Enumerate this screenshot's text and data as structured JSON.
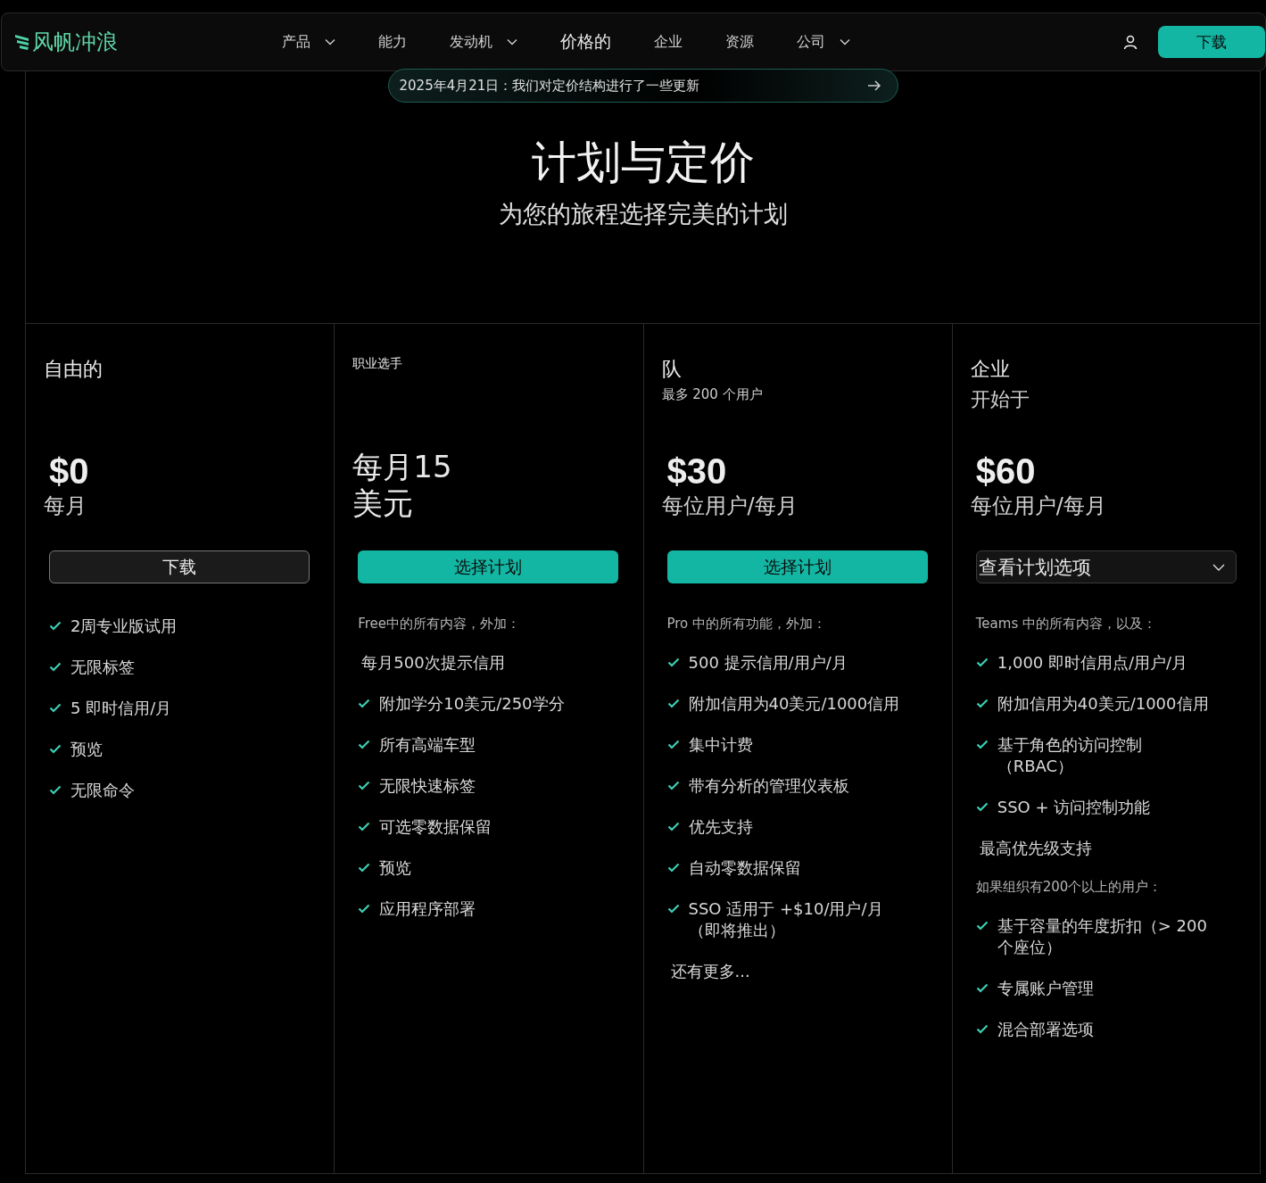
{
  "nav": {
    "logo": "风帆冲浪",
    "items": [
      {
        "label": "产品",
        "has_menu": true,
        "selected": false
      },
      {
        "label": "能力",
        "has_menu": false,
        "selected": false
      },
      {
        "label": "发动机",
        "has_menu": true,
        "selected": false
      },
      {
        "label": "价格的",
        "has_menu": false,
        "selected": true
      },
      {
        "label": "企业",
        "has_menu": false,
        "selected": false
      },
      {
        "label": "资源",
        "has_menu": false,
        "selected": false
      },
      {
        "label": "公司",
        "has_menu": true,
        "selected": false
      }
    ],
    "download": "下载"
  },
  "announcement": "2025年4月21日：我们对定价结构进行了一些更新",
  "hero": {
    "title": "计划与定价",
    "subtitle": "为您的旅程选择完美的计划"
  },
  "plans": [
    {
      "name": "自由的",
      "price": "$0",
      "kind": "amount",
      "period": "每月",
      "button": {
        "label": "下载",
        "kind": "secondary"
      },
      "features": [
        {
          "kind": "check",
          "text": "2周专业版试用"
        },
        {
          "kind": "check",
          "text": "无限标签"
        },
        {
          "kind": "check",
          "text": "5 即时信用/月"
        },
        {
          "kind": "check",
          "text": "预览"
        },
        {
          "kind": "check",
          "text": "无限命令"
        }
      ]
    },
    {
      "name": "职业选手",
      "price": "每月15美元",
      "kind": "text",
      "button": {
        "label": "选择计划",
        "kind": "primary"
      },
      "features": [
        {
          "kind": "note",
          "text": "Free中的所有内容，外加："
        },
        {
          "kind": "plain",
          "text": "每月500次提示信用"
        },
        {
          "kind": "check",
          "text": "附加学分10美元/250学分"
        },
        {
          "kind": "check",
          "text": "所有高端车型"
        },
        {
          "kind": "check",
          "text": "无限快速标签"
        },
        {
          "kind": "check",
          "text": "可选零数据保留"
        },
        {
          "kind": "check",
          "text": "预览"
        },
        {
          "kind": "check",
          "text": "应用程序部署"
        }
      ]
    },
    {
      "name": "队",
      "subtitle": "最多 200 个用户",
      "price": "$30",
      "kind": "amount",
      "period": "每位用户/每月",
      "button": {
        "label": "选择计划",
        "kind": "primary"
      },
      "features": [
        {
          "kind": "note",
          "text": "Pro 中的所有功能，外加："
        },
        {
          "kind": "check",
          "text": "500 提示信用/用户/月"
        },
        {
          "kind": "check",
          "text": "附加信用为40美元/1000信用"
        },
        {
          "kind": "check",
          "text": "集中计费"
        },
        {
          "kind": "check",
          "text": "带有分析的管理仪表板"
        },
        {
          "kind": "check",
          "text": "优先支持"
        },
        {
          "kind": "check",
          "text": "自动零数据保留"
        },
        {
          "kind": "check",
          "text": "SSO 适用于 +$10/用户/月（即将推出）"
        },
        {
          "kind": "plain",
          "text": "还有更多..."
        }
      ]
    },
    {
      "name": "企业",
      "subtitle": "开始于",
      "price": "$60",
      "kind": "amount",
      "period": "每位用户/每月",
      "button": {
        "label": "查看计划选项",
        "kind": "dropdown"
      },
      "features": [
        {
          "kind": "note",
          "text": "Teams 中的所有内容，以及："
        },
        {
          "kind": "check",
          "text": "1,000 即时信用点/用户/月"
        },
        {
          "kind": "check",
          "text": "附加信用为40美元/1000信用"
        },
        {
          "kind": "check",
          "text": "基于角色的访问控制（RBAC）"
        },
        {
          "kind": "check",
          "text": "SSO + 访问控制功能"
        },
        {
          "kind": "plain",
          "text": "最高优先级支持"
        },
        {
          "kind": "note",
          "text": "如果组织有200个以上的用户："
        },
        {
          "kind": "check",
          "text": "基于容量的年度折扣（> 200个座位）"
        },
        {
          "kind": "check",
          "text": "专属账户管理"
        },
        {
          "kind": "check",
          "text": "混合部署选项"
        }
      ]
    }
  ]
}
